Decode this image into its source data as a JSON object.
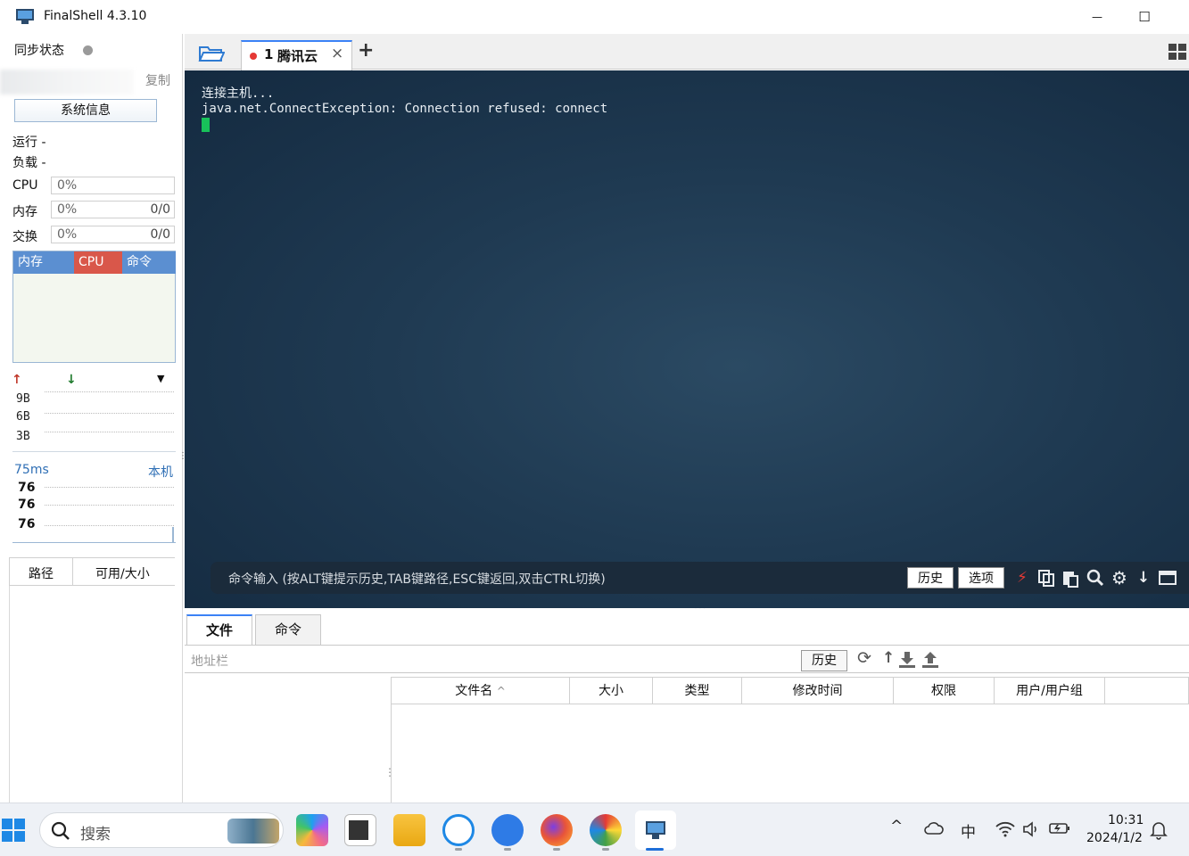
{
  "window": {
    "title": "FinalShell 4.3.10",
    "minimize_glyph": "—",
    "maximize_glyph": "☐",
    "close_glyph": "✕"
  },
  "sidebar": {
    "sync_label": "同步状态",
    "copy_label": "复制",
    "sysinfo_button": "系统信息",
    "run_label": "运行 -",
    "load_label": "负载 -",
    "cpu": {
      "label": "CPU",
      "percent": "0%"
    },
    "mem": {
      "label": "内存",
      "percent": "0%",
      "amount": "0/0"
    },
    "swap": {
      "label": "交换",
      "percent": "0%",
      "amount": "0/0"
    },
    "process_tabs": [
      {
        "label": "内存",
        "color": "#5b8fd1"
      },
      {
        "label": "CPU",
        "color": "#d9574a"
      },
      {
        "label": "命令",
        "color": "#5b8fd1"
      }
    ],
    "net_ticks": [
      "9B",
      "6B",
      "3B"
    ],
    "ping": {
      "latency": "75ms",
      "target": "本机",
      "values": [
        "76",
        "76",
        "76"
      ]
    },
    "disk_cols": {
      "path": "路径",
      "avail": "可用/大小"
    }
  },
  "tabs": {
    "session_index": "1",
    "session_name": "腾讯云",
    "close_glyph": "×",
    "add_glyph": "+"
  },
  "terminal": {
    "lines": [
      "连接主机...",
      "java.net.ConnectException: Connection refused: connect"
    ],
    "cmd_hint": "命令输入 (按ALT键提示历史,TAB键路径,ESC键返回,双击CTRL切换)",
    "history_button": "历史",
    "options_button": "选项"
  },
  "bottom": {
    "tabs": [
      "文件",
      "命令"
    ],
    "address_placeholder": "地址栏",
    "history_button": "历史",
    "file_columns": [
      "文件名",
      "大小",
      "类型",
      "修改时间",
      "权限",
      "用户/用户组"
    ],
    "sort_glyph": "^"
  },
  "taskbar": {
    "search_placeholder": "搜索",
    "ime": "中",
    "time": "10:31",
    "date": "2024/1/2"
  },
  "colors": {
    "accent": "#3b82f6",
    "terminal_bg": "#1f3a52",
    "cursor": "#18c25a",
    "cpu_tab": "#d9574a"
  }
}
